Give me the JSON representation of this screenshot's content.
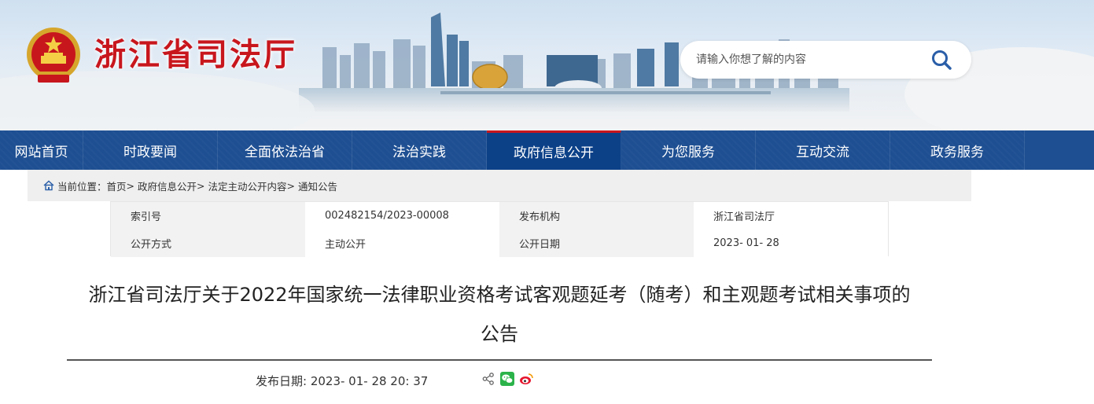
{
  "header": {
    "site_title": "浙江省司法厅",
    "emblem_icon": "national-emblem-icon",
    "search": {
      "placeholder": "请输入你想了解的内容",
      "value": "",
      "icon": "search-icon"
    }
  },
  "nav": {
    "items": [
      {
        "label": "网站首页",
        "active": false
      },
      {
        "label": "时政要闻",
        "active": false
      },
      {
        "label": "全面依法治省",
        "active": false
      },
      {
        "label": "法治实践",
        "active": false
      },
      {
        "label": "政府信息公开",
        "active": true
      },
      {
        "label": "为您服务",
        "active": false
      },
      {
        "label": "互动交流",
        "active": false
      },
      {
        "label": "政务服务",
        "active": false
      }
    ]
  },
  "breadcrumb": {
    "prefix": "当前位置：",
    "items": [
      "首页",
      "政府信息公开",
      "法定主动公开内容",
      "通知公告"
    ],
    "separator": ">"
  },
  "meta": {
    "index_label": "索引号",
    "index_value": "002482154/2023-00008",
    "org_label": "发布机构",
    "org_value": "浙江省司法厅",
    "method_label": "公开方式",
    "method_value": "主动公开",
    "date_label": "公开日期",
    "date_value": "2023- 01- 28"
  },
  "article": {
    "title_line1": "浙江省司法厅关于2022年国家统一法律职业资格考试客观题延考（随考）和主观题考试相关事项的",
    "title_line2": "公告",
    "publish_label": "发布日期: ",
    "publish_value": "2023- 01- 28 20: 37"
  },
  "share": {
    "icons": [
      "share-icon",
      "wechat-icon",
      "weibo-icon"
    ]
  },
  "colors": {
    "brand_red": "#c8161d",
    "nav_blue": "#1e4f92",
    "nav_active": "#0c4188"
  }
}
